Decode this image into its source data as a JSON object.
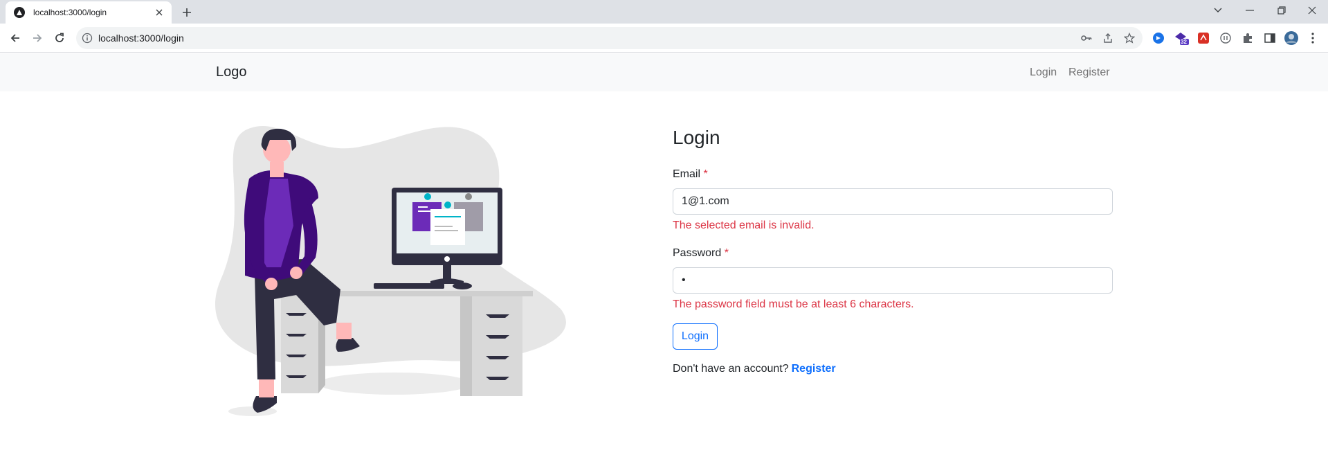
{
  "browser": {
    "tab_title": "localhost:3000/login",
    "url": "localhost:3000/login",
    "extension_badge": "32"
  },
  "navbar": {
    "brand": "Logo",
    "links": [
      "Login",
      "Register"
    ]
  },
  "form": {
    "title": "Login",
    "email": {
      "label": "Email",
      "required_mark": "*",
      "value": "1@1.com",
      "error": "The selected email is invalid."
    },
    "password": {
      "label": "Password",
      "required_mark": "*",
      "value": "•",
      "error": "The password field must be at least 6 characters."
    },
    "submit_label": "Login",
    "signup_prompt": "Don't have an account?",
    "signup_link": "Register"
  },
  "colors": {
    "primary": "#0d6efd",
    "danger": "#dc3545",
    "navbar_bg": "#f8f9fa",
    "illustration_accent": "#6c2bb8"
  }
}
